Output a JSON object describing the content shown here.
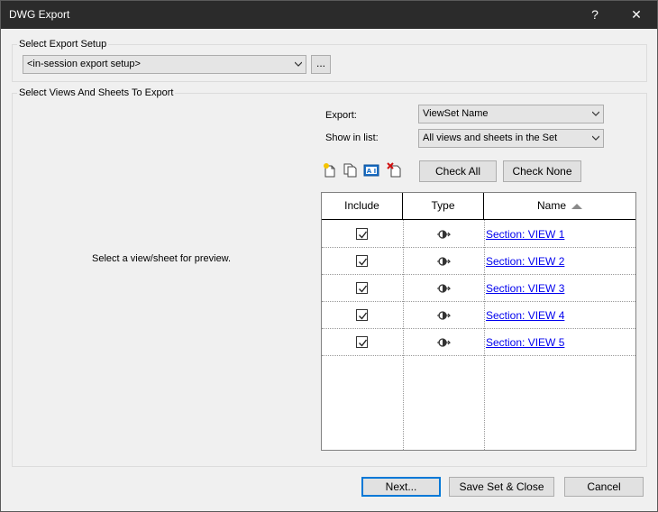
{
  "window": {
    "title": "DWG Export",
    "help_label": "?",
    "close_label": "✕"
  },
  "export_setup": {
    "group_label": "Select Export Setup",
    "selected": "<in-session export setup>",
    "more_button": "..."
  },
  "views": {
    "group_label": "Select Views And Sheets To Export",
    "preview_text": "Select a view/sheet for preview.",
    "export_label": "Export:",
    "export_value": "ViewSet Name",
    "show_label": "Show in list:",
    "show_value": "All views and sheets in the Set",
    "toolbar_icons": [
      "new-set-icon",
      "duplicate-set-icon",
      "rename-set-icon",
      "delete-set-icon"
    ],
    "check_all": "Check All",
    "check_none": "Check None",
    "columns": [
      "Include",
      "Type",
      "Name"
    ],
    "sort_column": "Name",
    "rows": [
      {
        "checked": true,
        "type_icon": "section-view-icon",
        "name": "Section: VIEW 1"
      },
      {
        "checked": true,
        "type_icon": "section-view-icon",
        "name": "Section: VIEW 2"
      },
      {
        "checked": true,
        "type_icon": "section-view-icon",
        "name": "Section: VIEW 3"
      },
      {
        "checked": true,
        "type_icon": "section-view-icon",
        "name": "Section: VIEW 4"
      },
      {
        "checked": true,
        "type_icon": "section-view-icon",
        "name": "Section: VIEW 5"
      }
    ]
  },
  "footer": {
    "next": "Next...",
    "save_close": "Save Set & Close",
    "cancel": "Cancel"
  }
}
